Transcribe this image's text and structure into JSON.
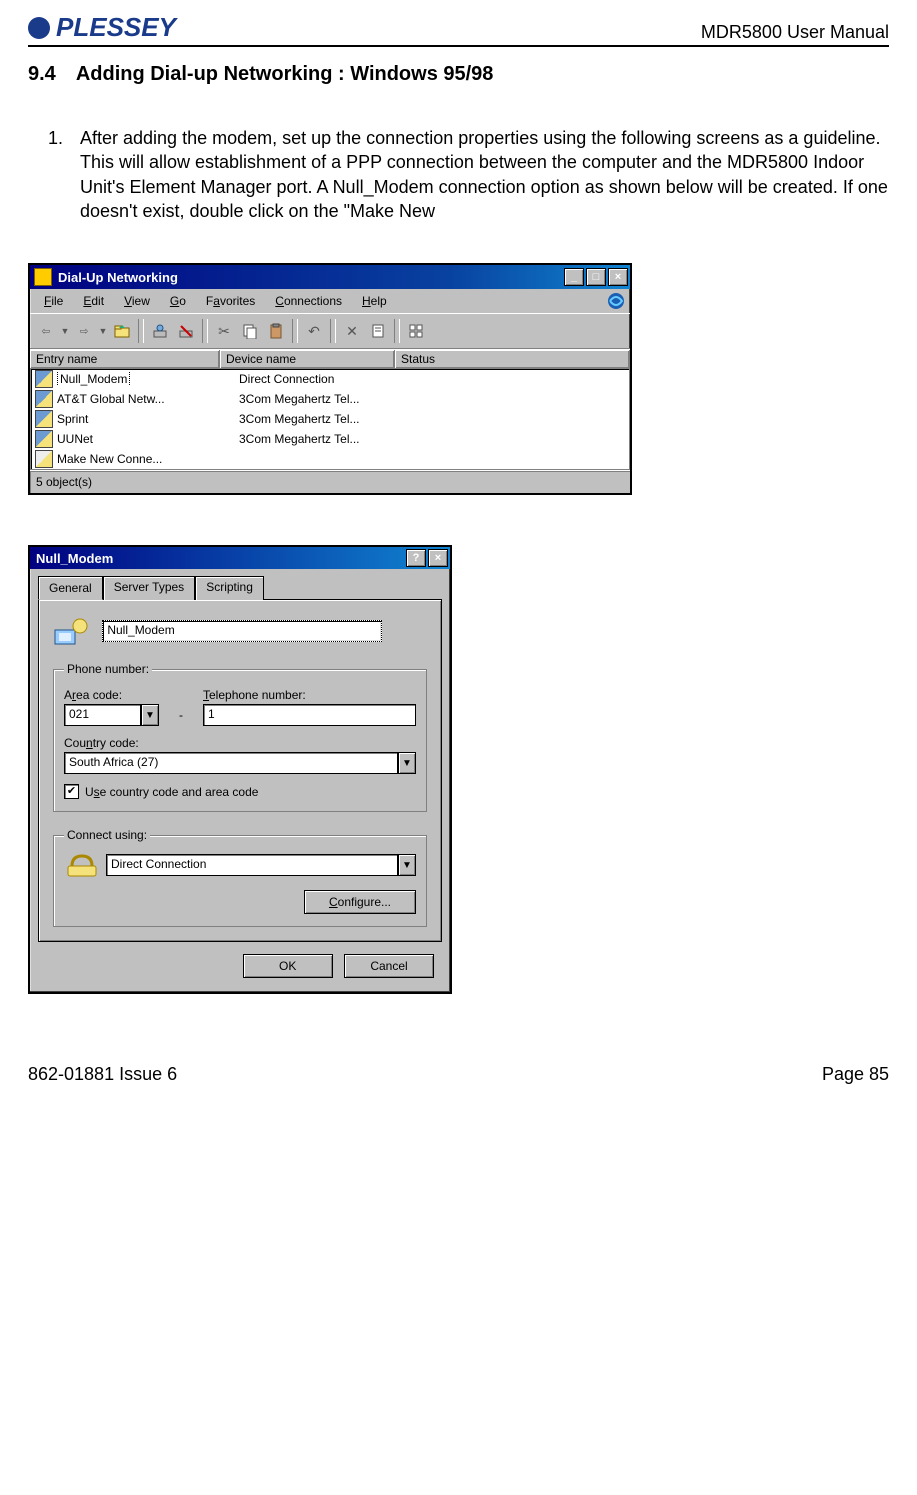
{
  "header": {
    "brand": "PLESSEY",
    "document": "MDR5800 User Manual"
  },
  "section": {
    "number": "9.4",
    "title": "Adding Dial-up Networking : Windows 95/98"
  },
  "steps": [
    {
      "n": "1.",
      "text": "After adding the modem, set up the connection properties using the following screens as a guideline.  This will allow establishment of a PPP connection between the computer and the MDR5800 Indoor Unit's Element Manager port.  A Null_Modem connection option as shown below will be created.  If one doesn't exist, double click on the \"Make New"
    }
  ],
  "dun_window": {
    "title": "Dial-Up Networking",
    "menus": [
      "File",
      "Edit",
      "View",
      "Go",
      "Favorites",
      "Connections",
      "Help"
    ],
    "columns": [
      "Entry name",
      "Device name",
      "Status"
    ],
    "rows": [
      {
        "entry": "Null_Modem",
        "device": "Direct Connection",
        "status": "",
        "selected": true,
        "icon": "conn"
      },
      {
        "entry": "AT&T Global Netw...",
        "device": "3Com Megahertz Tel...",
        "status": "",
        "icon": "conn"
      },
      {
        "entry": "Sprint",
        "device": "3Com Megahertz Tel...",
        "status": "",
        "icon": "conn"
      },
      {
        "entry": "UUNet",
        "device": "3Com Megahertz Tel...",
        "status": "",
        "icon": "conn"
      },
      {
        "entry": "Make New Conne...",
        "device": "",
        "status": "",
        "icon": "make"
      }
    ],
    "status": "5 object(s)"
  },
  "nm_dialog": {
    "title": "Null_Modem",
    "tabs": [
      "General",
      "Server Types",
      "Scripting"
    ],
    "conn_name": "Null_Modem",
    "phone_group": "Phone number:",
    "area_label": "Area code:",
    "tel_label": "Telephone number:",
    "area_value": "021",
    "tel_value": "1",
    "dash": "-",
    "country_label": "Country code:",
    "country_value": "South Africa (27)",
    "use_cc_label": "Use country code and area code",
    "use_cc_checked": true,
    "connect_group": "Connect using:",
    "connect_value": "Direct Connection",
    "configure_btn": "Configure...",
    "ok_btn": "OK",
    "cancel_btn": "Cancel"
  },
  "footer": {
    "left": "862-01881 Issue 6",
    "right": "Page 85"
  }
}
